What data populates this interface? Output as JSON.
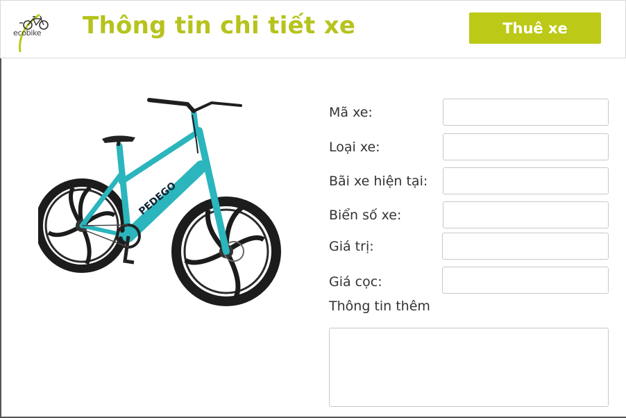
{
  "header": {
    "logo_text": "ecobike",
    "title": "Thông tin chi tiết xe",
    "rent_button_label": "Thuê xe"
  },
  "colors": {
    "accent": "#bcc916",
    "title": "#b6c31d",
    "bike_frame": "#2bb5bd"
  },
  "bike_image": {
    "frame_text": "PEDEGO"
  },
  "form": {
    "bike_id_label": "Mã xe:",
    "bike_id_value": "",
    "bike_type_label": "Loại xe:",
    "bike_type_value": "",
    "current_station_label": "Bãi xe hiện tại:",
    "current_station_value": "",
    "license_plate_label": "Biển số xe:",
    "license_plate_value": "",
    "value_label": "Giá trị:",
    "value_value": "",
    "deposit_label": "Giá cọc:",
    "deposit_value": "",
    "extra_info_label": "Thông tin thêm",
    "extra_info_value": ""
  }
}
